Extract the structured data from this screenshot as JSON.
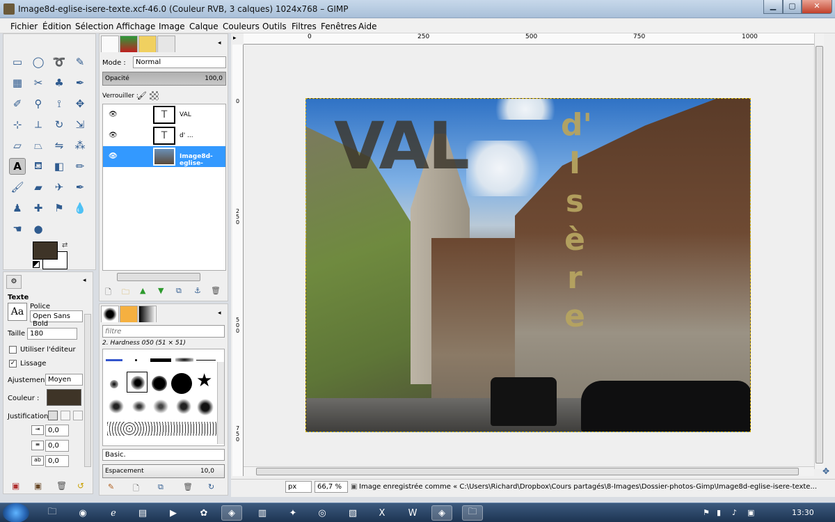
{
  "window": {
    "title": "Image8d-eglise-isere-texte.xcf-46.0 (Couleur RVB, 3 calques) 1024x768 – GIMP"
  },
  "menubar": {
    "items": [
      "Fichier",
      "Édition",
      "Sélection",
      "Affichage",
      "Image",
      "Calque",
      "Couleurs",
      "Outils",
      "Filtres",
      "Fenêtres",
      "Aide"
    ]
  },
  "tool_options": {
    "section_title": "Texte",
    "font_label": "Police",
    "font_value": "Open Sans Bold",
    "font_icon_text": "Aa",
    "size_label": "Taille :",
    "size_value": "180",
    "use_editor_label": "Utiliser l'éditeur",
    "antialias_label": "Lissage",
    "hinting_label": "Ajustement :",
    "hinting_value": "Moyen",
    "color_label": "Couleur :",
    "justify_label": "Justification :",
    "indent_value": "0,0",
    "line_spacing_value": "0,0",
    "letter_spacing_value": "0,0"
  },
  "layers": {
    "mode_label": "Mode :",
    "mode_value": "Normal",
    "opacity_label": "Opacité",
    "opacity_value": "100,0",
    "lock_label": "Verrouiller :",
    "items": [
      {
        "name": "VAL"
      },
      {
        "name": "d' ..."
      },
      {
        "name": "Image8d-eglise-"
      }
    ]
  },
  "brushes": {
    "filter_placeholder": "filtre",
    "selected_brush": "2. Hardness 050 (51 × 51)",
    "category_value": "Basic.",
    "spacing_label": "Espacement",
    "spacing_value": "10,0"
  },
  "canvas": {
    "ruler_marks": [
      "0",
      "250",
      "500",
      "750",
      "1000"
    ],
    "vruler_marks": [
      "0",
      "250",
      "500",
      "750"
    ],
    "text_val": "VAL",
    "text_isere": [
      "d'",
      "I",
      "s",
      "è",
      "r",
      "e"
    ]
  },
  "statusbar": {
    "unit": "px",
    "zoom": "66,7 %",
    "message": "Image enregistrée comme « C:\\Users\\Richard\\Dropbox\\Cours partagés\\8-Images\\Dossier-photos-Gimp\\Image8d-eglise-isere-texte..."
  },
  "taskbar": {
    "time": "13:30"
  },
  "colors": {
    "foreground": "#3e3427",
    "selection": "#3399ff",
    "text_isere": "#b5a360"
  }
}
